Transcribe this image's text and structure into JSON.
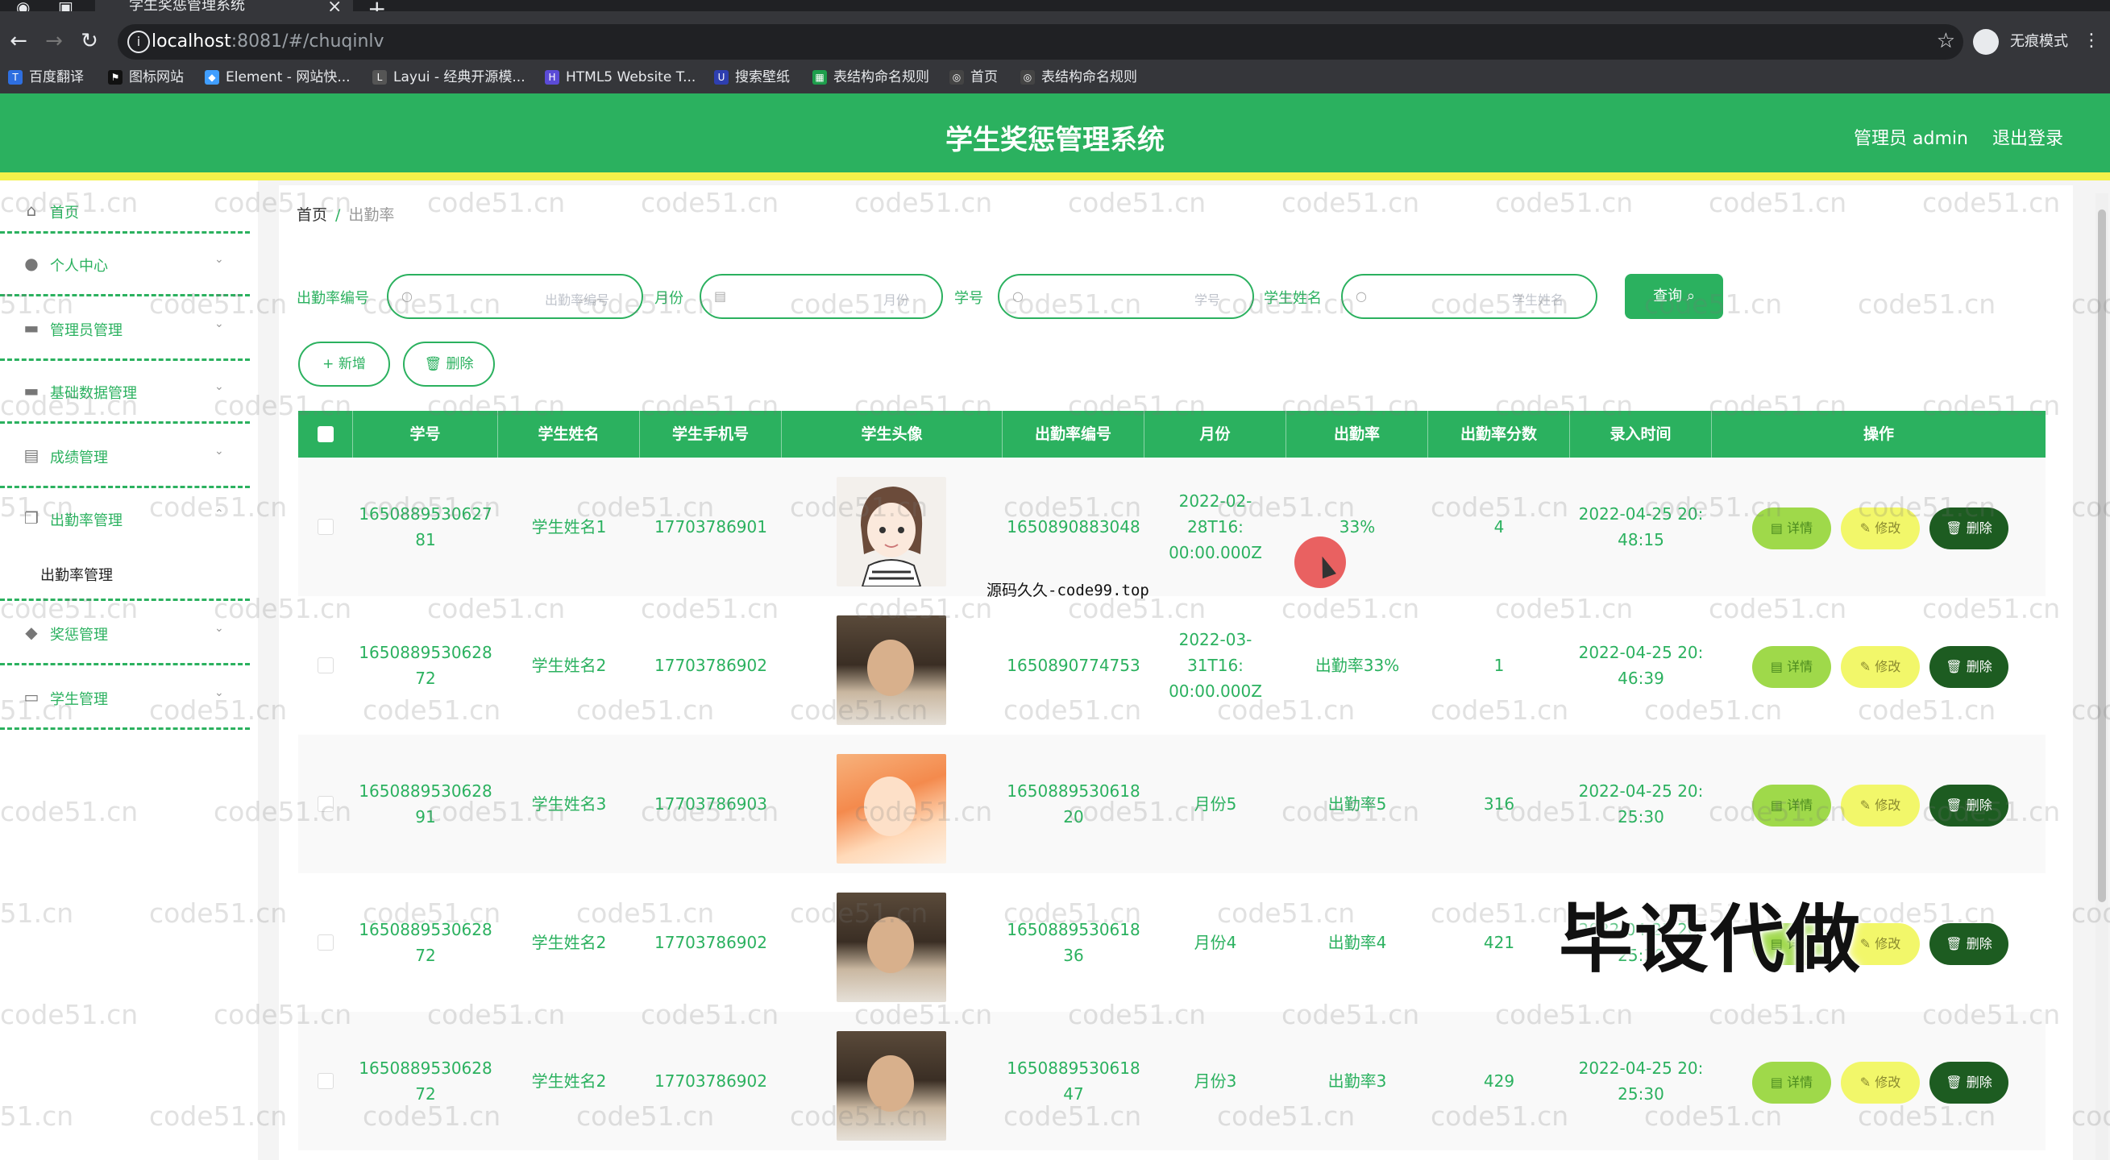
{
  "browser": {
    "tab_title": "学生奖惩管理系统",
    "url_host": "localhost",
    "url_path": ":8081/#/chuqinlv",
    "profile_label": "无痕模式",
    "bookmarks": [
      "百度翻译",
      "图标网站",
      "Element - 网站快...",
      "Layui - 经典开源模...",
      "HTML5 Website T...",
      "搜索壁纸",
      "表结构命名规则",
      "首页",
      "表结构命名规则"
    ]
  },
  "header": {
    "title": "学生奖惩管理系统",
    "user": "管理员 admin",
    "logout": "退出登录"
  },
  "sidebar": {
    "items": [
      {
        "label": "首页",
        "icon": "home-icon"
      },
      {
        "label": "个人中心",
        "icon": "user-icon"
      },
      {
        "label": "管理员管理",
        "icon": "admin-icon"
      },
      {
        "label": "基础数据管理",
        "icon": "data-icon"
      },
      {
        "label": "成绩管理",
        "icon": "score-icon"
      },
      {
        "label": "出勤率管理",
        "icon": "attendance-icon"
      },
      {
        "label": "奖惩管理",
        "icon": "award-icon"
      },
      {
        "label": "学生管理",
        "icon": "student-icon"
      }
    ],
    "sub_item": "出勤率管理"
  },
  "breadcrumb": {
    "home": "首页",
    "sep": "/",
    "current": "出勤率"
  },
  "search": {
    "f1_label": "出勤率编号",
    "f1_ph": "出勤率编号",
    "f2_label": "月份",
    "f2_ph": "月份",
    "f3_label": "学号",
    "f3_ph": "学号",
    "f4_label": "学生姓名",
    "f4_ph": "学生姓名",
    "query": "查询"
  },
  "actions": {
    "add": "+ 新增",
    "delete": "删除"
  },
  "table": {
    "headers": [
      "学号",
      "学生姓名",
      "学生手机号",
      "学生头像",
      "出勤率编号",
      "月份",
      "出勤率",
      "出勤率分数",
      "录入时间",
      "操作"
    ],
    "rows": [
      {
        "xuehao": "1650889530627 81",
        "name": "学生姓名1",
        "phone": "17703786901",
        "avatar": "girl",
        "code": "1650890883048",
        "month": "2022-02-28T16: 00:00.000Z",
        "rate": "33%",
        "score": "4",
        "time": "2022-04-25 20: 48:15"
      },
      {
        "xuehao": "1650889530628 72",
        "name": "学生姓名2",
        "phone": "17703786902",
        "avatar": "boy",
        "code": "1650890774753",
        "month": "2022-03-31T16: 00:00.000Z",
        "rate": "出勤率33%",
        "score": "1",
        "time": "2022-04-25 20: 46:39"
      },
      {
        "xuehao": "1650889530628 91",
        "name": "学生姓名3",
        "phone": "17703786903",
        "avatar": "woman",
        "code": "1650889530618 20",
        "month": "月份5",
        "rate": "出勤率5",
        "score": "316",
        "time": "2022-04-25 20: 25:30"
      },
      {
        "xuehao": "1650889530628 72",
        "name": "学生姓名2",
        "phone": "17703786902",
        "avatar": "boy",
        "code": "1650889530618 36",
        "month": "月份4",
        "rate": "出勤率4",
        "score": "421",
        "time": "2022-04-25 20: 25:30"
      },
      {
        "xuehao": "1650889530628 72",
        "name": "学生姓名2",
        "phone": "17703786902",
        "avatar": "boy",
        "code": "1650889530618 47",
        "month": "月份3",
        "rate": "出勤率3",
        "score": "429",
        "time": "2022-04-25 20: 25:30"
      }
    ],
    "op_detail": "详情",
    "op_edit": "修改",
    "op_delete": "删除"
  },
  "overlay": {
    "source_text": "源码久久-code99.top",
    "banner": "毕设代做",
    "watermark": "code51.cn"
  }
}
